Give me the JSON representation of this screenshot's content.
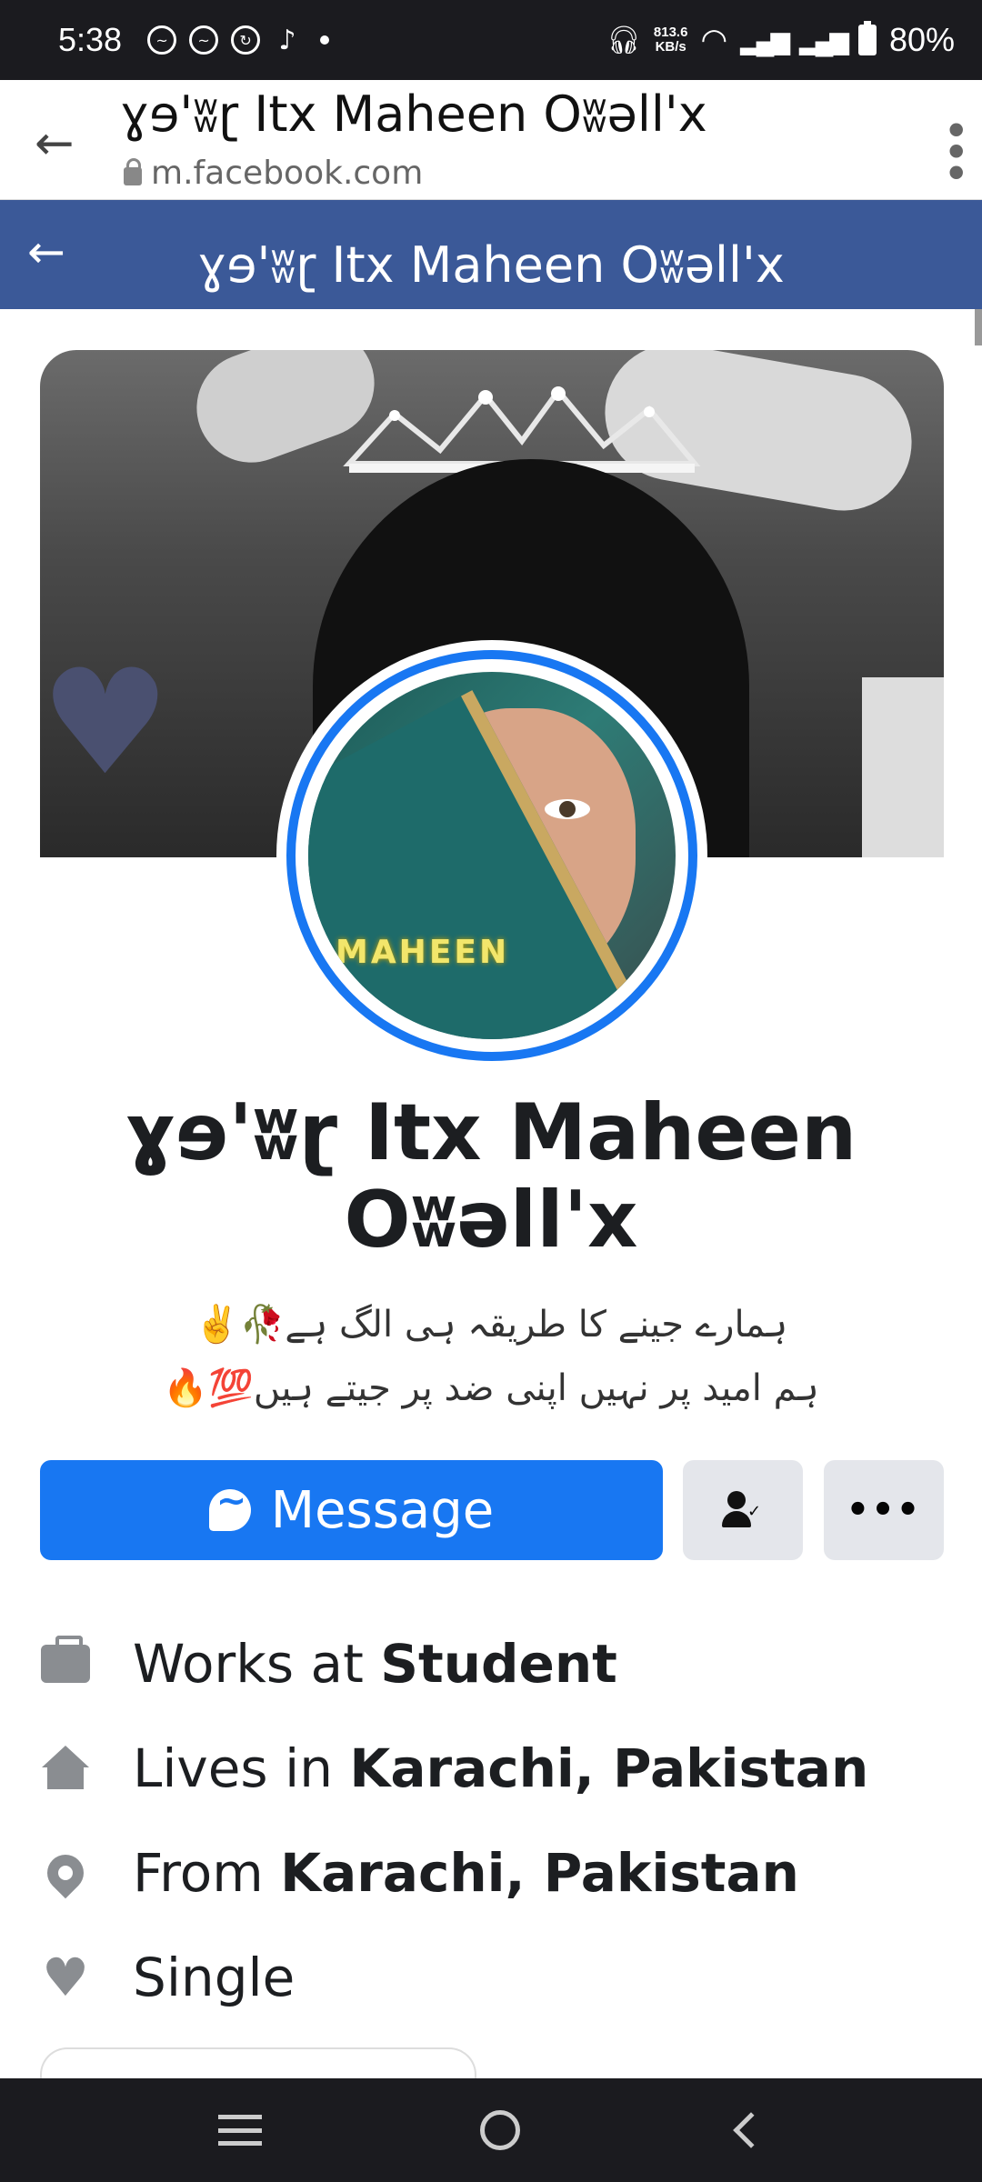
{
  "status_bar": {
    "time": "5:38",
    "net_speed_value": "813.6",
    "net_speed_unit": "KB/s",
    "battery": "80%"
  },
  "browser": {
    "title": "ɣɘ'ʬɽ Itx Maheen Oʬəll'x",
    "url": "m.facebook.com"
  },
  "fb_header": {
    "title": "ɣɘ'ʬɽ Itx Maheen Oʬəll'x"
  },
  "profile": {
    "avatar_label": "MAHEEN",
    "name": "ɣɘ'ʬɽ Itx Maheen Oʬəll'x",
    "bio_line1": "ہمارے جینے کا طریقہ ہی الگ ہے🥀✌️",
    "bio_line2": "ہم امید پر نہیں اپنی ضد پر جیتے ہیں💯🔥"
  },
  "actions": {
    "message_label": "Message",
    "more_label": "•••"
  },
  "details": {
    "work_prefix": "Works at ",
    "work_value": "Student",
    "lives_prefix": "Lives in ",
    "lives_value": "Karachi, Pakistan",
    "from_prefix": "From ",
    "from_value": "Karachi, Pakistan",
    "relationship": "Single"
  },
  "icons": {
    "work": "briefcase-icon",
    "lives": "home-icon",
    "from": "location-pin-icon",
    "relationship": "heart-icon"
  },
  "colors": {
    "fb_header": "#3b5998",
    "primary_button": "#1877f2",
    "secondary_button": "#e4e6eb",
    "status_bar": "#1b1b1f"
  }
}
